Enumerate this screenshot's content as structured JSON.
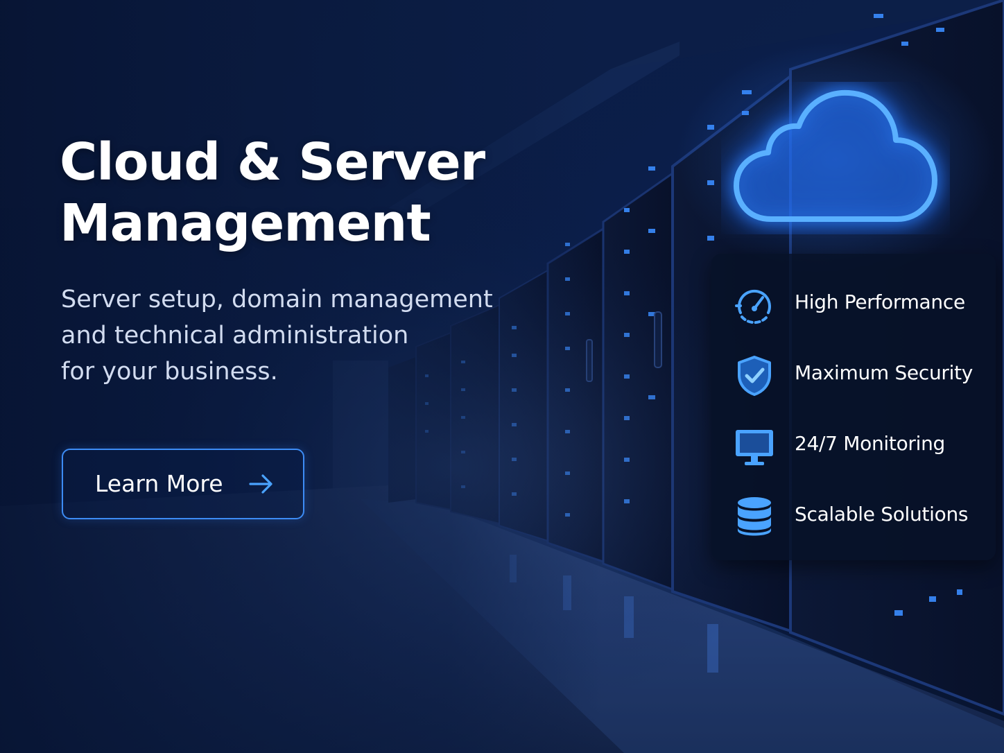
{
  "hero": {
    "title_line1": "Cloud & Server",
    "title_line2": "Management",
    "subtitle_lines": [
      "Server setup, domain management",
      "and technical administration",
      "for your business."
    ],
    "cta_label": "Learn More",
    "cta_icon": "arrow-right-icon",
    "cloud_icon": "cloud-icon"
  },
  "features": [
    {
      "label": "High Performance",
      "icon": "speedometer-icon"
    },
    {
      "label": "Maximum Security",
      "icon": "shield-check-icon"
    },
    {
      "label": "24/7 Monitoring",
      "icon": "monitor-icon"
    },
    {
      "label": "Scalable Solutions",
      "icon": "database-icon"
    }
  ],
  "colors": {
    "background": "#0b1d45",
    "accent": "#3d8cf5",
    "icon": "#4aa3ff",
    "text": "#ffffff",
    "subtitle": "#d2dcf0"
  }
}
